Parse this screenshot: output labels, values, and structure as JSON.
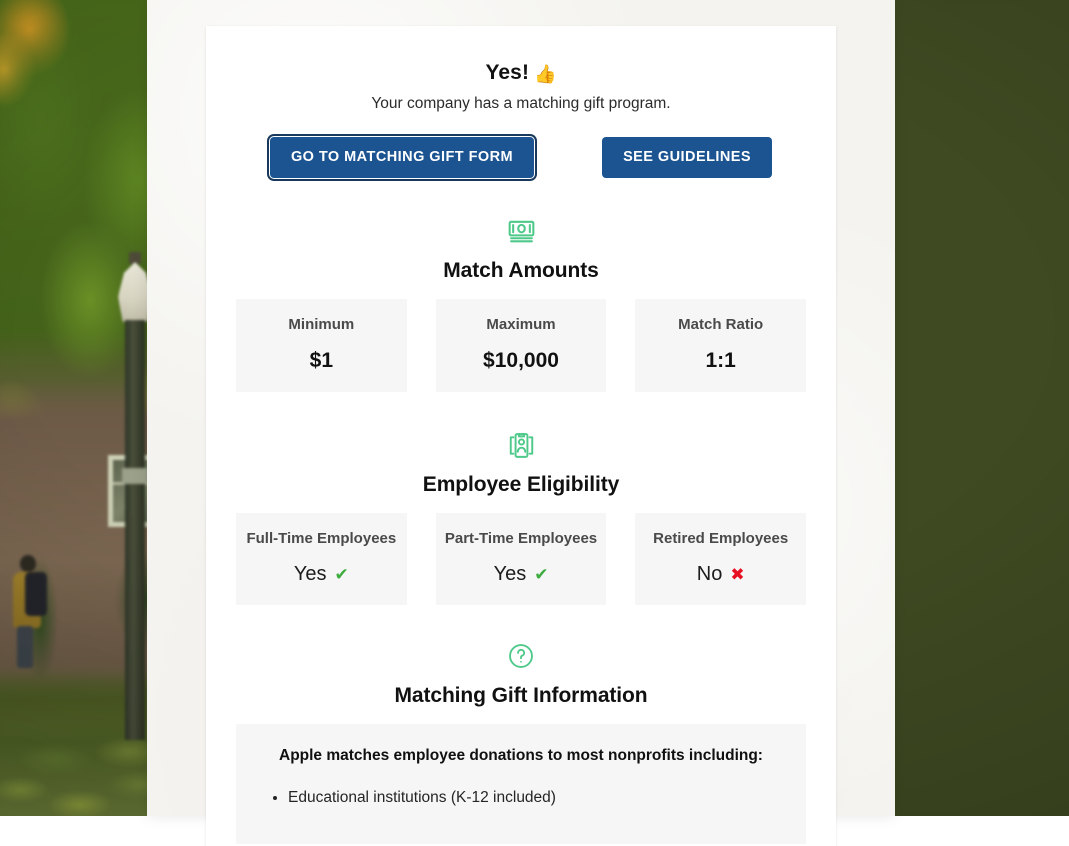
{
  "background": {
    "scene_description": "blurred autumn campus photo with brick building, trees, lamp post and a student walking"
  },
  "card": {
    "headline": "Yes!",
    "headline_emoji": "👍",
    "subheadline": "Your company has a matching gift program.",
    "buttons": [
      {
        "label": "GO TO MATCHING GIFT FORM",
        "name": "go-to-matching-gift-form-button",
        "focused": true
      },
      {
        "label": "SEE GUIDELINES",
        "name": "see-guidelines-button",
        "focused": false
      }
    ],
    "sections": [
      {
        "icon": "money-stack-icon",
        "title": "Match Amounts",
        "stats": [
          {
            "label": "Minimum",
            "value": "$1"
          },
          {
            "label": "Maximum",
            "value": "$10,000"
          },
          {
            "label": "Match Ratio",
            "value": "1:1"
          }
        ]
      },
      {
        "icon": "employee-id-badge-icon",
        "title": "Employee Eligibility",
        "stats": [
          {
            "label": "Full-Time Employees",
            "value": "Yes",
            "mark": "✔",
            "mark_type": "yes"
          },
          {
            "label": "Part-Time Employees",
            "value": "Yes",
            "mark": "✔",
            "mark_type": "yes"
          },
          {
            "label": "Retired Employees",
            "value": "No",
            "mark": "✖",
            "mark_type": "no"
          }
        ]
      },
      {
        "icon": "question-circle-icon",
        "title": "Matching Gift Information",
        "info_heading": "Apple matches employee donations to most nonprofits including:",
        "info_items": [
          "Educational institutions (K-12 included)"
        ]
      }
    ]
  },
  "colors": {
    "button_blue": "#1b5491",
    "icon_green": "#4ec98a",
    "yes_green": "#3eac3e",
    "no_red": "#e81123",
    "stat_box_bg": "#f6f6f6",
    "card_bg": "#ffffff",
    "panel_bg": "#f4f3ef"
  }
}
